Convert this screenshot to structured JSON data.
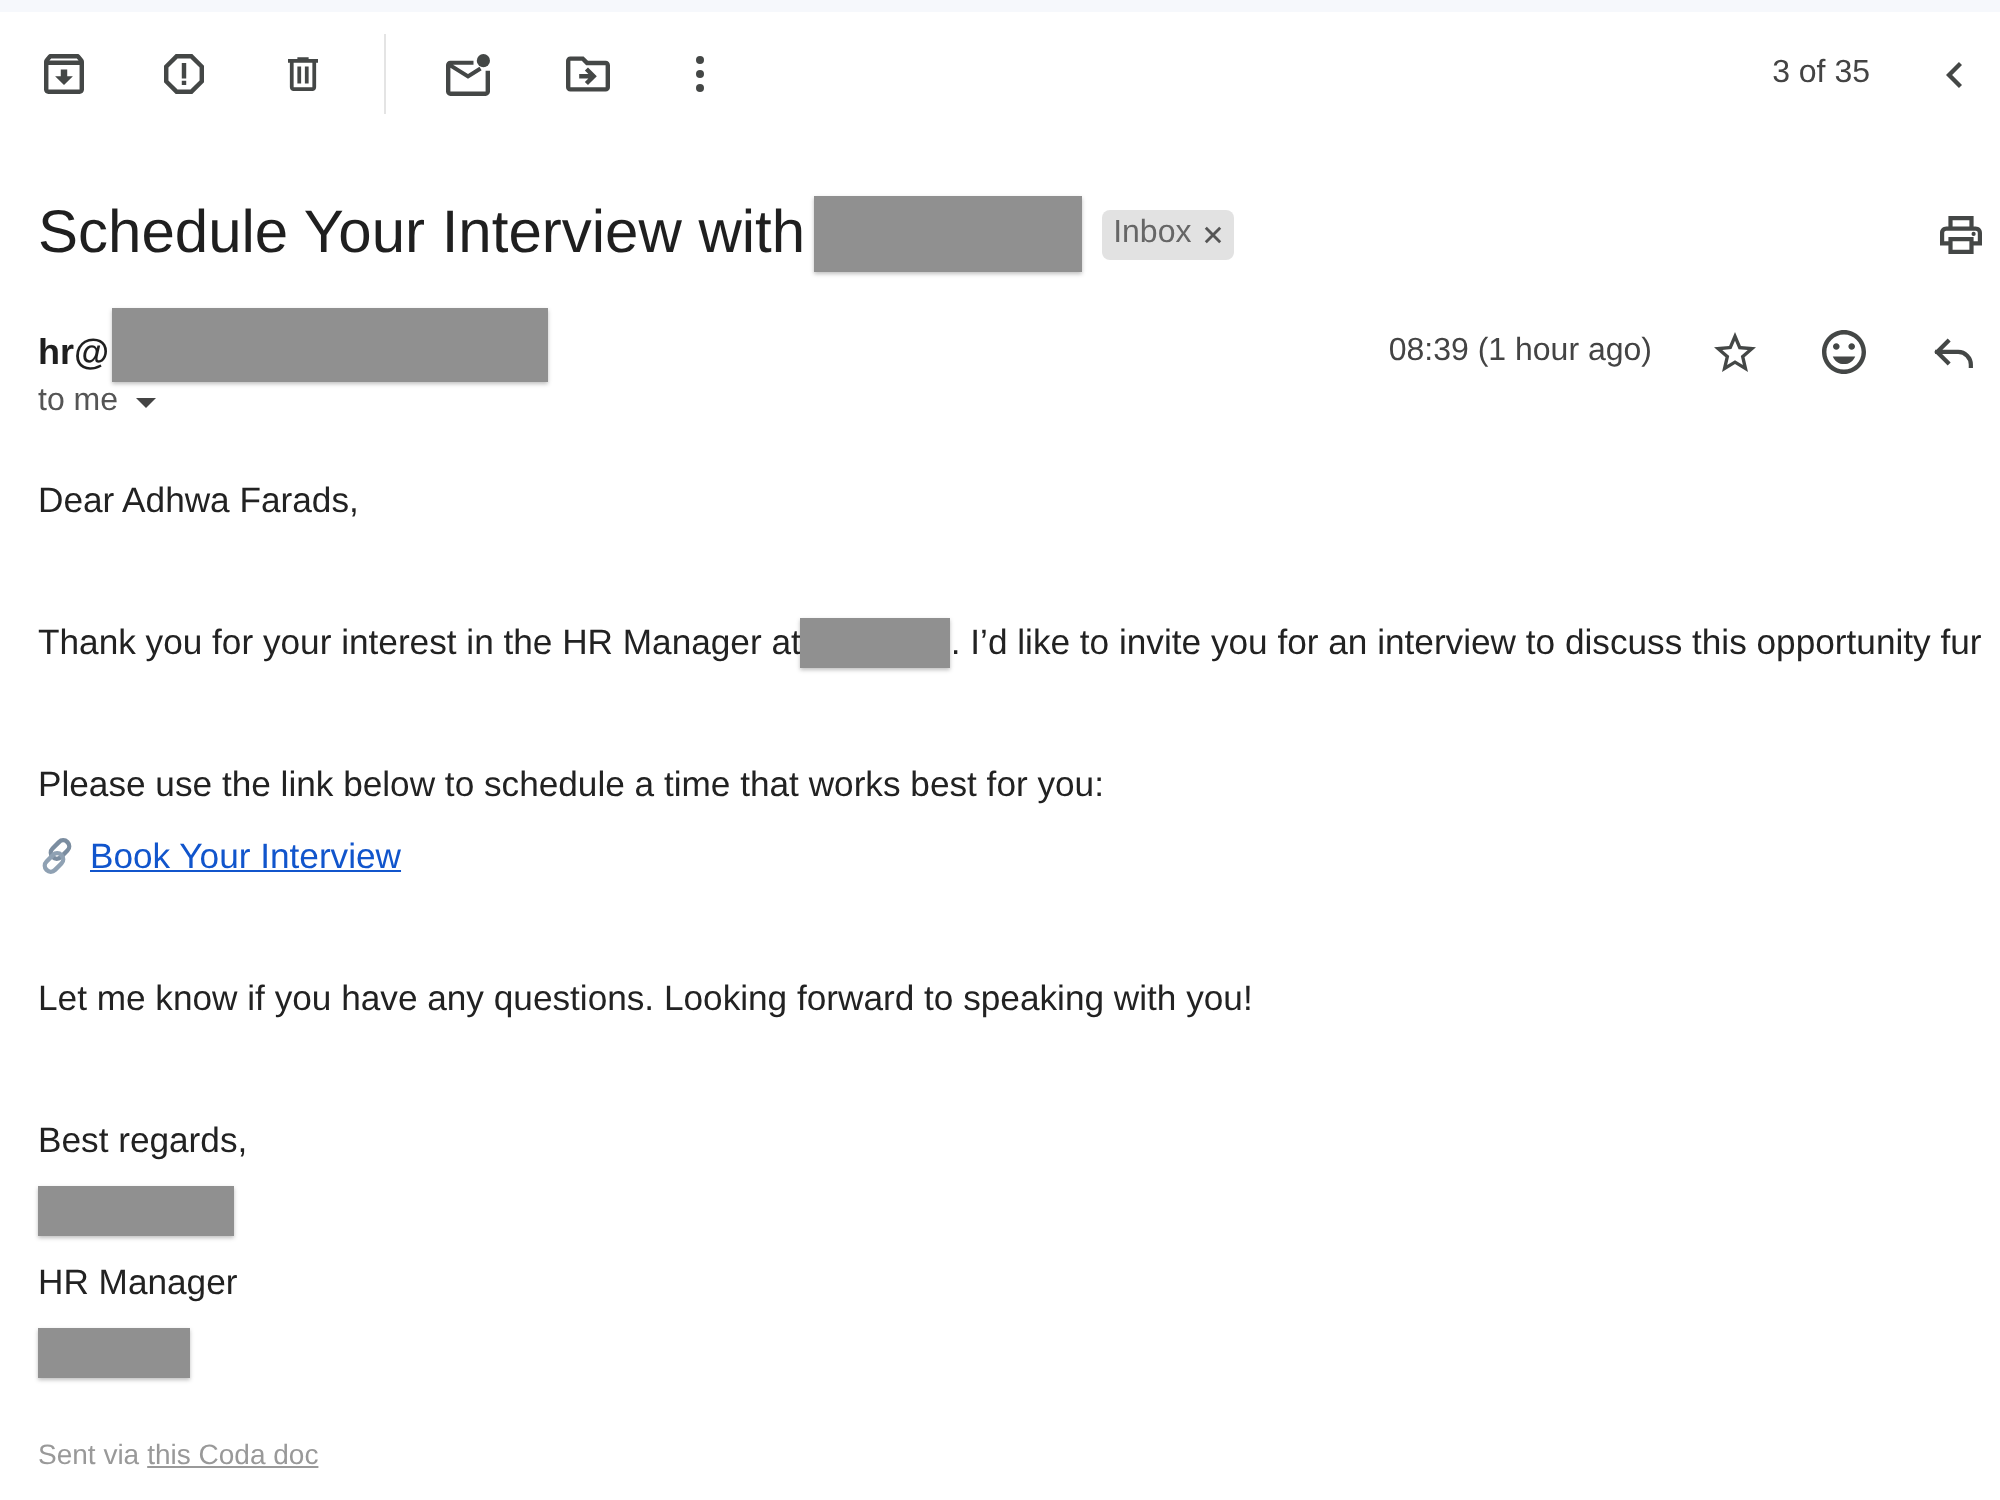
{
  "toolbar": {
    "pager": "3 of 35"
  },
  "subject": {
    "text": "Schedule Your Interview with",
    "redacted": true,
    "labels": [
      {
        "text": "Inbox",
        "removable": true
      }
    ]
  },
  "sender": {
    "email": "hr@",
    "redacted": true,
    "recipient": "to me",
    "time": "08:39 (1 hour ago)"
  },
  "body": [
    {
      "lines": [
        {
          "segments": [
            {
              "kind": "text",
              "text": "Dear Adhwa Farads,"
            }
          ]
        }
      ]
    },
    {
      "lines": [
        {
          "segments": [
            {
              "kind": "text",
              "text": "Thank you for your interest in the HR Manager at"
            },
            {
              "kind": "redacted"
            },
            {
              "kind": "text",
              "text": ". I’d like to invite you for an interview to discuss this opportunity fur"
            }
          ]
        }
      ]
    },
    {
      "lines": [
        {
          "segments": [
            {
              "kind": "text",
              "text": "Please use the link below to schedule a time that works best for you:"
            }
          ]
        },
        {
          "segments": [
            {
              "kind": "link",
              "text": "Book Your Interview"
            }
          ]
        }
      ]
    },
    {
      "lines": [
        {
          "segments": [
            {
              "kind": "text",
              "text": "Let me know if you have any questions. Looking forward to speaking with you!"
            }
          ]
        }
      ]
    },
    {
      "lines": [
        {
          "segments": [
            {
              "kind": "text",
              "text": "Best regards,"
            }
          ]
        },
        {
          "segments": [
            {
              "kind": "redacted"
            }
          ]
        },
        {
          "segments": [
            {
              "kind": "text",
              "text": "HR Manager"
            }
          ]
        },
        {
          "segments": [
            {
              "kind": "redacted"
            }
          ]
        }
      ]
    }
  ],
  "footer": {
    "text": "Sent via",
    "link": "this Coda doc"
  }
}
